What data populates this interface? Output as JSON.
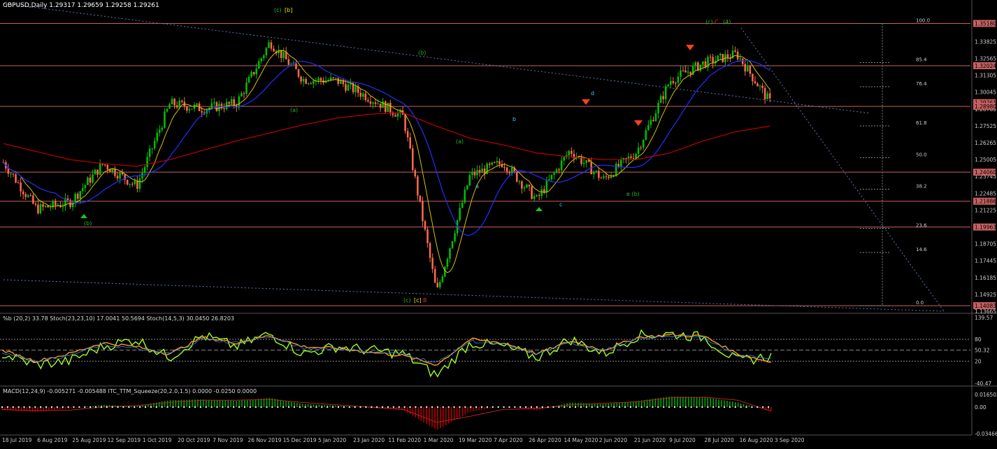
{
  "symbol_header": "GBPUSD,Daily  1.29317 1.29659 1.29258 1.29261",
  "indicator_header": "%b (20,2) 33.78  Stoch(23,23,10) 17.0041 50.5694  Stoch(14,5,3) 30.0450 26.8203",
  "macd_header": "MACD(12,24,9) -0.005271 -0.005488  ITC_TTM_Squeeze(20,2.0,1.5) 0.0000 -0.0250 0.0000",
  "colors": {
    "background": "#000000",
    "bull_candle": "#00c000",
    "bear_candle": "#ff6a4a",
    "sma200": "#c00000",
    "ema_blue": "#2030ff",
    "ema_yellow": "#d8c000",
    "hline": "#c86060",
    "price_label_bg": "#c86060",
    "stoch_green": "#a0ff20",
    "stoch_orange": "#ff9a10",
    "stoch_blue": "#3080ff",
    "macd_pos": "#00b000",
    "macd_neg": "#c00000",
    "wave_label_green": "#1dbe1d",
    "wave_label_red": "#e03030"
  },
  "chart_data": [
    {
      "type": "candlestick",
      "title": "GBPUSD,Daily",
      "ohlc_last": {
        "open": 1.29317,
        "high": 1.29659,
        "low": 1.29258,
        "close": 1.29261
      },
      "y_axis_ticks": [
        "1.35180",
        "1.33825",
        "1.32565",
        "1.31305",
        "1.30045",
        "1.28785",
        "1.27525",
        "1.26265",
        "1.25005",
        "1.23745",
        "1.22485",
        "1.21225",
        "1.19965",
        "1.18705",
        "1.17445",
        "1.16185",
        "1.14925",
        "1.13665"
      ],
      "ylim": [
        1.13665,
        1.362
      ],
      "x_axis_labels": [
        "18 Jul 2019",
        "6 Aug 2019",
        "25 Aug 2019",
        "12 Sep 2019",
        "1 Oct 2019",
        "20 Oct 2019",
        "7 Nov 2019",
        "26 Nov 2019",
        "15 Dec 2019",
        "5 Jan 2020",
        "23 Jan 2020",
        "11 Feb 2020",
        "1 Mar 2020",
        "19 Mar 2020",
        "7 Apr 2020",
        "26 Apr 2020",
        "14 May 2020",
        "2 Jun 2020",
        "21 Jun 2020",
        "9 Jul 2020",
        "28 Jul 2020",
        "16 Aug 2020",
        "3 Sep 2020"
      ],
      "price_labels": [
        {
          "value": 1.3518,
          "text": "1.35180"
        },
        {
          "value": 1.3202,
          "text": "1.32024"
        },
        {
          "value": 1.2926,
          "text": "1.29261"
        },
        {
          "value": 1.2898,
          "text": "1.28980"
        },
        {
          "value": 1.2406,
          "text": "1.24060"
        },
        {
          "value": 1.2189,
          "text": "1.21886"
        },
        {
          "value": 1.1996,
          "text": "1.19963"
        },
        {
          "value": 1.1408,
          "text": "1.14083"
        }
      ],
      "horizontal_lines": [
        1.3518,
        1.3202,
        1.2898,
        1.2406,
        1.2189,
        1.1996,
        1.1408
      ],
      "fibonacci_levels": [
        {
          "text": "100.0",
          "value": 1.3518
        },
        {
          "text": "85.4",
          "value": 1.3225
        },
        {
          "text": "76.4",
          "value": 1.3045
        },
        {
          "text": "61.8",
          "value": 1.2752
        },
        {
          "text": "50.0",
          "value": 1.2515
        },
        {
          "text": "38.2",
          "value": 1.2279
        },
        {
          "text": "23.6",
          "value": 1.1986
        },
        {
          "text": "14.6",
          "value": 1.1806
        },
        {
          "text": "0.0",
          "value": 1.1408
        }
      ],
      "wave_labels": [
        {
          "text": "(c)",
          "color": "green",
          "date_index": 0.3
        },
        {
          "text": "[b]",
          "color": "yellow"
        },
        {
          "text": "(b)"
        },
        {
          "text": "(a)"
        },
        {
          "text": "(b)"
        },
        {
          "text": "(a)"
        },
        {
          "text": "b"
        },
        {
          "text": "d"
        },
        {
          "text": "a"
        },
        {
          "text": "c"
        },
        {
          "text": "e (b)"
        },
        {
          "text": "(c)"
        },
        {
          "text": "[c]"
        },
        {
          "text": "B"
        },
        {
          "text": "(c)"
        },
        {
          "text": "C"
        },
        {
          "text": "(4)"
        }
      ],
      "series": [
        {
          "name": "close",
          "x": [
            "2019-07-18",
            "2019-08-06",
            "2019-08-25",
            "2019-09-12",
            "2019-10-01",
            "2019-10-20",
            "2019-11-07",
            "2019-11-26",
            "2019-12-15",
            "2020-01-05",
            "2020-01-23",
            "2020-02-11",
            "2020-03-01",
            "2020-03-19",
            "2020-04-07",
            "2020-04-26",
            "2020-05-14",
            "2020-06-02",
            "2020-06-21",
            "2020-07-09",
            "2020-07-28",
            "2020-08-16",
            "2020-09-03",
            "2020-09-14"
          ],
          "values": [
            1.248,
            1.213,
            1.218,
            1.247,
            1.23,
            1.292,
            1.288,
            1.292,
            1.338,
            1.31,
            1.309,
            1.296,
            1.282,
            1.15,
            1.238,
            1.248,
            1.22,
            1.257,
            1.235,
            1.256,
            1.309,
            1.322,
            1.329,
            1.293
          ]
        },
        {
          "name": "SMA 200",
          "values": [
            1.262,
            1.256,
            1.25,
            1.247,
            1.245,
            1.25,
            1.257,
            1.264,
            1.27,
            1.276,
            1.281,
            1.284,
            1.285,
            1.275,
            1.266,
            1.261,
            1.255,
            1.252,
            1.25,
            1.25,
            1.255,
            1.264,
            1.271,
            1.275
          ]
        }
      ]
    },
    {
      "type": "line",
      "panel": "oscillator",
      "y_axis_ticks": [
        "139.57",
        "80",
        "50.32",
        "20",
        "-40.47"
      ],
      "ylim": [
        -40.47,
        139.57
      ],
      "series": [
        {
          "name": "%b",
          "values": [
            40,
            10,
            20,
            60,
            80,
            30,
            90,
            60,
            95,
            40,
            60,
            50,
            40,
            -20,
            70,
            60,
            30,
            80,
            40,
            90,
            95,
            85,
            20,
            33.78
          ]
        },
        {
          "name": "Stoch(23,23,10)",
          "values": [
            50,
            20,
            40,
            70,
            60,
            40,
            85,
            70,
            90,
            60,
            55,
            45,
            35,
            10,
            80,
            70,
            40,
            75,
            50,
            85,
            92,
            88,
            40,
            17.0
          ]
        },
        {
          "name": "Stoch(14,5,3)",
          "values": [
            45,
            20,
            35,
            65,
            55,
            40,
            80,
            70,
            88,
            55,
            55,
            45,
            40,
            15,
            75,
            65,
            40,
            70,
            50,
            80,
            90,
            85,
            35,
            30.0
          ]
        }
      ]
    },
    {
      "type": "bar",
      "panel": "macd",
      "y_axis_ticks": [
        "0.016502",
        "0.00",
        "-0.034669"
      ],
      "ylim": [
        -0.034669,
        0.016502
      ],
      "series": [
        {
          "name": "MACD",
          "values": [
            -0.004,
            -0.006,
            -0.002,
            0.003,
            0.001,
            0.009,
            0.01,
            0.008,
            0.012,
            0.004,
            0.002,
            -0.001,
            -0.004,
            -0.03,
            -0.006,
            0.001,
            -0.004,
            0.006,
            0.004,
            0.008,
            0.014,
            0.013,
            0.006,
            -0.005271
          ]
        },
        {
          "name": "Signal",
          "values": [
            -0.003,
            -0.005,
            -0.004,
            0.0,
            0.002,
            0.006,
            0.009,
            0.009,
            0.01,
            0.006,
            0.003,
            0.0,
            -0.003,
            -0.02,
            -0.012,
            -0.003,
            -0.002,
            0.003,
            0.005,
            0.007,
            0.012,
            0.013,
            0.009,
            -0.005488
          ]
        }
      ]
    }
  ]
}
